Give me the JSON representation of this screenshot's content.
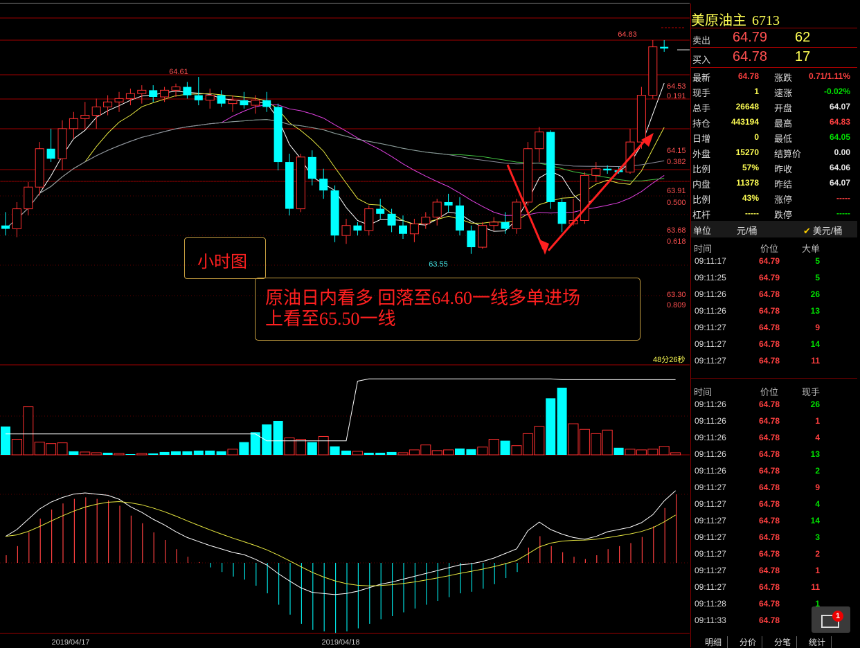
{
  "quote": {
    "title": "美原油主",
    "code": "6713",
    "sell": {
      "label": "卖出",
      "price": "64.79",
      "vol": "62"
    },
    "buy": {
      "label": "买入",
      "price": "64.78",
      "vol": "17"
    },
    "rows": [
      {
        "l1": "最新",
        "v1": "64.78",
        "c1": "red",
        "l2": "涨跌",
        "v2": "0.71/1.11%",
        "c2": "red"
      },
      {
        "l1": "现手",
        "v1": "1",
        "c1": "yel",
        "l2": "速涨",
        "v2": "-0.02%",
        "c2": "grn"
      },
      {
        "l1": "总手",
        "v1": "26648",
        "c1": "yel",
        "l2": "开盘",
        "v2": "64.07",
        "c2": "wht"
      },
      {
        "l1": "持仓",
        "v1": "443194",
        "c1": "yel",
        "l2": "最高",
        "v2": "64.83",
        "c2": "red"
      },
      {
        "l1": "日增",
        "v1": "0",
        "c1": "yel",
        "l2": "最低",
        "v2": "64.05",
        "c2": "grn"
      },
      {
        "l1": "外盘",
        "v1": "15270",
        "c1": "yel",
        "l2": "结算价",
        "v2": "0.00",
        "c2": "wht"
      },
      {
        "l1": "比例",
        "v1": "57%",
        "c1": "yel",
        "l2": "昨收",
        "v2": "64.06",
        "c2": "wht"
      },
      {
        "l1": "内盘",
        "v1": "11378",
        "c1": "yel",
        "l2": "昨结",
        "v2": "64.07",
        "c2": "wht"
      },
      {
        "l1": "比例",
        "v1": "43%",
        "c1": "yel",
        "l2": "涨停",
        "v2": "-----",
        "c2": "red"
      },
      {
        "l1": "杠杆",
        "v1": "-----",
        "c1": "yel",
        "l2": "跌停",
        "v2": "-----",
        "c2": "grn"
      }
    ],
    "unit_label": "单位",
    "unit_value": "元/桶",
    "unit_option": "美元/桶"
  },
  "big_orders": {
    "headers": [
      "时间",
      "价位",
      "大单"
    ],
    "rows": [
      {
        "t": "09:11:17",
        "p": "64.79",
        "n": "5",
        "c": "grn"
      },
      {
        "t": "09:11:25",
        "p": "64.79",
        "n": "5",
        "c": "grn"
      },
      {
        "t": "09:11:26",
        "p": "64.78",
        "n": "26",
        "c": "grn"
      },
      {
        "t": "09:11:26",
        "p": "64.78",
        "n": "13",
        "c": "grn"
      },
      {
        "t": "09:11:27",
        "p": "64.78",
        "n": "9",
        "c": "red"
      },
      {
        "t": "09:11:27",
        "p": "64.78",
        "n": "14",
        "c": "grn"
      },
      {
        "t": "09:11:27",
        "p": "64.78",
        "n": "11",
        "c": "red"
      }
    ]
  },
  "ticks": {
    "headers": [
      "时间",
      "价位",
      "现手"
    ],
    "rows": [
      {
        "t": "09:11:26",
        "p": "64.78",
        "n": "26",
        "c": "grn"
      },
      {
        "t": "09:11:26",
        "p": "64.78",
        "n": "1",
        "c": "red"
      },
      {
        "t": "09:11:26",
        "p": "64.78",
        "n": "4",
        "c": "red"
      },
      {
        "t": "09:11:26",
        "p": "64.78",
        "n": "13",
        "c": "grn"
      },
      {
        "t": "09:11:26",
        "p": "64.78",
        "n": "2",
        "c": "grn"
      },
      {
        "t": "09:11:27",
        "p": "64.78",
        "n": "9",
        "c": "red"
      },
      {
        "t": "09:11:27",
        "p": "64.78",
        "n": "4",
        "c": "grn"
      },
      {
        "t": "09:11:27",
        "p": "64.78",
        "n": "14",
        "c": "grn"
      },
      {
        "t": "09:11:27",
        "p": "64.78",
        "n": "3",
        "c": "grn"
      },
      {
        "t": "09:11:27",
        "p": "64.78",
        "n": "2",
        "c": "red"
      },
      {
        "t": "09:11:27",
        "p": "64.78",
        "n": "1",
        "c": "red"
      },
      {
        "t": "09:11:27",
        "p": "64.78",
        "n": "11",
        "c": "red"
      },
      {
        "t": "09:11:28",
        "p": "64.78",
        "n": "1",
        "c": "grn"
      },
      {
        "t": "09:11:33",
        "p": "64.78",
        "n": "1",
        "c": "grn"
      }
    ]
  },
  "tabs": [
    "明细",
    "分价",
    "分笔",
    "统计"
  ],
  "mail_badge": "1",
  "annotations": {
    "box1": "小时图",
    "box2_line1": "原油日内看多 回落至64.60一线多单进场",
    "box2_line2": "上看至65.50一线"
  },
  "chart_data": {
    "type": "candlestick",
    "ylim": [
      63.2,
      64.9
    ],
    "hi_label": "64.83",
    "lo_label": "63.55",
    "left_hi_label": "64.61",
    "fib_levels": [
      {
        "price": "64.53",
        "ratio": "0.191"
      },
      {
        "price": "64.15",
        "ratio": "0.382"
      },
      {
        "price": "63.91",
        "ratio": "0.500"
      },
      {
        "price": "63.68",
        "ratio": "0.618"
      },
      {
        "price": "63.30",
        "ratio": "0.809"
      }
    ],
    "countdown": "48分26秒",
    "dates": [
      "2019/04/17",
      "2019/04/18"
    ],
    "candles": [
      {
        "o": 63.72,
        "h": 63.8,
        "l": 63.66,
        "c": 63.7
      },
      {
        "o": 63.7,
        "h": 63.86,
        "l": 63.65,
        "c": 63.82
      },
      {
        "o": 63.82,
        "h": 63.98,
        "l": 63.78,
        "c": 63.95
      },
      {
        "o": 63.95,
        "h": 64.22,
        "l": 63.9,
        "c": 64.18
      },
      {
        "o": 64.18,
        "h": 64.3,
        "l": 64.1,
        "c": 64.12
      },
      {
        "o": 64.12,
        "h": 64.35,
        "l": 64.05,
        "c": 64.3
      },
      {
        "o": 64.3,
        "h": 64.4,
        "l": 64.24,
        "c": 64.36
      },
      {
        "o": 64.36,
        "h": 64.46,
        "l": 64.3,
        "c": 64.38
      },
      {
        "o": 64.38,
        "h": 64.48,
        "l": 64.3,
        "c": 64.43
      },
      {
        "o": 64.43,
        "h": 64.5,
        "l": 64.38,
        "c": 64.46
      },
      {
        "o": 64.46,
        "h": 64.52,
        "l": 64.4,
        "c": 64.48
      },
      {
        "o": 64.48,
        "h": 64.54,
        "l": 64.44,
        "c": 64.51
      },
      {
        "o": 64.51,
        "h": 64.56,
        "l": 64.45,
        "c": 64.53
      },
      {
        "o": 64.53,
        "h": 64.56,
        "l": 64.46,
        "c": 64.49
      },
      {
        "o": 64.49,
        "h": 64.55,
        "l": 64.46,
        "c": 64.53
      },
      {
        "o": 64.53,
        "h": 64.57,
        "l": 64.49,
        "c": 64.55
      },
      {
        "o": 64.55,
        "h": 64.58,
        "l": 64.48,
        "c": 64.5
      },
      {
        "o": 64.5,
        "h": 64.61,
        "l": 64.44,
        "c": 64.47
      },
      {
        "o": 64.47,
        "h": 64.54,
        "l": 64.42,
        "c": 64.5
      },
      {
        "o": 64.5,
        "h": 64.53,
        "l": 64.43,
        "c": 64.45
      },
      {
        "o": 64.45,
        "h": 64.5,
        "l": 64.4,
        "c": 64.47
      },
      {
        "o": 64.47,
        "h": 64.52,
        "l": 64.42,
        "c": 64.44
      },
      {
        "o": 64.44,
        "h": 64.5,
        "l": 64.39,
        "c": 64.47
      },
      {
        "o": 64.47,
        "h": 64.52,
        "l": 64.4,
        "c": 64.43
      },
      {
        "o": 64.43,
        "h": 64.45,
        "l": 64.05,
        "c": 64.1
      },
      {
        "o": 64.1,
        "h": 64.15,
        "l": 63.78,
        "c": 63.82
      },
      {
        "o": 63.82,
        "h": 64.15,
        "l": 63.8,
        "c": 64.13
      },
      {
        "o": 64.13,
        "h": 64.17,
        "l": 63.96,
        "c": 64.0
      },
      {
        "o": 64.0,
        "h": 64.06,
        "l": 63.88,
        "c": 63.93
      },
      {
        "o": 63.93,
        "h": 63.96,
        "l": 63.62,
        "c": 63.66
      },
      {
        "o": 63.66,
        "h": 63.76,
        "l": 63.61,
        "c": 63.72
      },
      {
        "o": 63.72,
        "h": 63.74,
        "l": 63.66,
        "c": 63.69
      },
      {
        "o": 63.69,
        "h": 63.84,
        "l": 63.66,
        "c": 63.82
      },
      {
        "o": 63.82,
        "h": 63.88,
        "l": 63.76,
        "c": 63.79
      },
      {
        "o": 63.79,
        "h": 63.82,
        "l": 63.68,
        "c": 63.72
      },
      {
        "o": 63.72,
        "h": 63.78,
        "l": 63.64,
        "c": 63.67
      },
      {
        "o": 63.67,
        "h": 63.76,
        "l": 63.62,
        "c": 63.73
      },
      {
        "o": 63.73,
        "h": 63.8,
        "l": 63.7,
        "c": 63.77
      },
      {
        "o": 63.77,
        "h": 63.88,
        "l": 63.72,
        "c": 63.86
      },
      {
        "o": 63.86,
        "h": 63.91,
        "l": 63.8,
        "c": 63.84
      },
      {
        "o": 63.84,
        "h": 63.89,
        "l": 63.66,
        "c": 63.69
      },
      {
        "o": 63.69,
        "h": 63.72,
        "l": 63.55,
        "c": 63.59
      },
      {
        "o": 63.59,
        "h": 63.74,
        "l": 63.58,
        "c": 63.72
      },
      {
        "o": 63.72,
        "h": 63.77,
        "l": 63.69,
        "c": 63.74
      },
      {
        "o": 63.74,
        "h": 63.8,
        "l": 63.67,
        "c": 63.7
      },
      {
        "o": 63.7,
        "h": 63.88,
        "l": 63.67,
        "c": 63.86
      },
      {
        "o": 63.86,
        "h": 64.22,
        "l": 63.84,
        "c": 64.18
      },
      {
        "o": 64.18,
        "h": 64.31,
        "l": 64.1,
        "c": 64.28
      },
      {
        "o": 64.28,
        "h": 64.29,
        "l": 63.82,
        "c": 63.86
      },
      {
        "o": 63.86,
        "h": 63.88,
        "l": 63.68,
        "c": 63.73
      },
      {
        "o": 63.73,
        "h": 63.88,
        "l": 63.72,
        "c": 63.75
      },
      {
        "o": 63.75,
        "h": 64.04,
        "l": 63.73,
        "c": 64.02
      },
      {
        "o": 64.02,
        "h": 64.1,
        "l": 63.98,
        "c": 64.06
      },
      {
        "o": 64.06,
        "h": 64.08,
        "l": 64.03,
        "c": 64.05
      },
      {
        "o": 64.05,
        "h": 64.07,
        "l": 64.03,
        "c": 64.04
      },
      {
        "o": 64.04,
        "h": 64.3,
        "l": 64.03,
        "c": 64.22
      },
      {
        "o": 64.22,
        "h": 64.55,
        "l": 64.18,
        "c": 64.5
      },
      {
        "o": 64.5,
        "h": 64.83,
        "l": 64.48,
        "c": 64.79
      },
      {
        "o": 64.79,
        "h": 64.83,
        "l": 64.76,
        "c": 64.78
      }
    ],
    "volume": [
      40,
      22,
      68,
      18,
      16,
      17,
      5,
      4,
      3,
      3,
      2,
      1,
      2,
      2,
      4,
      5,
      5,
      6,
      6,
      5,
      8,
      18,
      32,
      43,
      48,
      24,
      22,
      18,
      26,
      12,
      6,
      5,
      3,
      3,
      4,
      3,
      7,
      14,
      6,
      7,
      9,
      8,
      11,
      22,
      20,
      13,
      30,
      40,
      80,
      95,
      44,
      36,
      30,
      35,
      10,
      8,
      7,
      8,
      12,
      3
    ],
    "vol_dir": [
      0,
      1,
      1,
      1,
      1,
      1,
      0,
      1,
      1,
      0,
      1,
      0,
      1,
      0,
      0,
      0,
      0,
      0,
      0,
      0,
      1,
      0,
      0,
      0,
      0,
      1,
      1,
      0,
      1,
      0,
      0,
      1,
      0,
      0,
      0,
      1,
      1,
      1,
      1,
      1,
      0,
      0,
      1,
      1,
      0,
      1,
      1,
      1,
      0,
      0,
      1,
      1,
      1,
      1,
      0,
      1,
      1,
      1,
      1,
      1
    ],
    "oi_line": [
      0.27,
      0.27,
      0.27,
      0.27,
      0.27,
      0.27,
      0.27,
      0.27,
      0.27,
      0.27,
      0.27,
      0.27,
      0.27,
      0.27,
      0.27,
      0.27,
      0.27,
      0.27,
      0.27,
      0.27,
      0.27,
      0.27,
      0.27,
      0.18,
      0.18,
      0.18,
      0.18,
      0.18,
      0.18,
      0.18,
      0.18,
      0.95,
      0.98,
      0.98,
      0.98,
      0.98,
      0.98,
      0.98,
      0.98,
      0.98,
      0.98,
      0.98,
      0.98,
      0.98,
      0.98,
      0.98,
      0.98,
      0.98,
      0.98,
      0.97,
      0.97,
      0.97,
      0.97,
      0.97,
      0.97,
      0.97,
      0.97,
      0.97,
      0.97,
      0.97
    ],
    "macd": [
      0.1,
      0.22,
      0.4,
      0.58,
      0.7,
      0.78,
      0.84,
      0.86,
      0.84,
      0.82,
      0.75,
      0.62,
      0.52,
      0.4,
      0.3,
      0.18,
      0.08,
      0.01,
      -0.06,
      -0.12,
      -0.18,
      -0.22,
      -0.3,
      -0.4,
      -0.55,
      -0.68,
      -0.8,
      -0.88,
      -0.9,
      -0.92,
      -0.9,
      -0.86,
      -0.8,
      -0.74,
      -0.7,
      -0.65,
      -0.6,
      -0.55,
      -0.5,
      -0.45,
      -0.4,
      -0.38,
      -0.34,
      -0.28,
      -0.2,
      -0.12,
      0.2,
      0.35,
      0.22,
      0.14,
      0.08,
      0.05,
      0.1,
      0.18,
      0.22,
      0.26,
      0.34,
      0.48,
      0.72,
      0.9
    ]
  }
}
